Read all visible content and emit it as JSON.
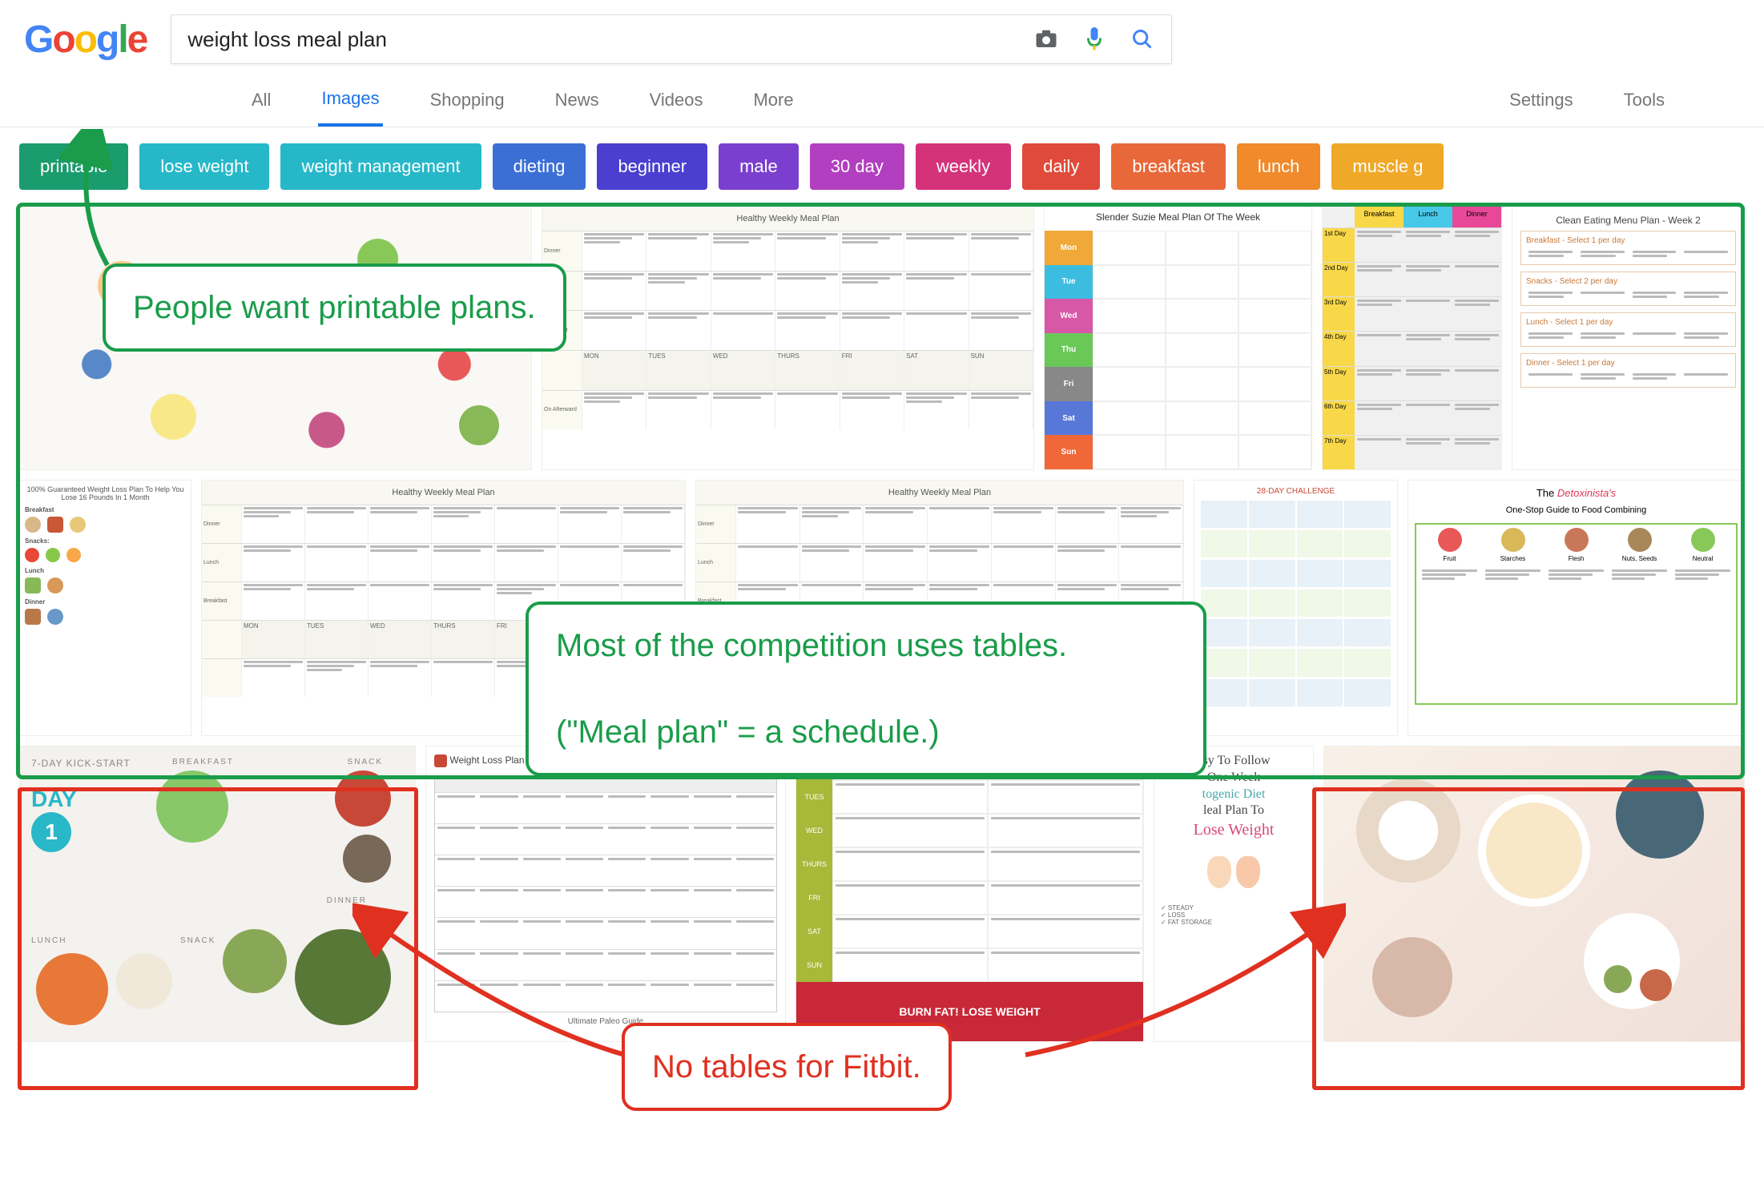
{
  "logo": "Google",
  "search": {
    "query": "weight loss meal plan",
    "camera_icon": "camera",
    "mic_icon": "microphone",
    "search_icon": "search"
  },
  "tabs": {
    "all": "All",
    "images": "Images",
    "shopping": "Shopping",
    "news": "News",
    "videos": "Videos",
    "more": "More",
    "settings": "Settings",
    "tools": "Tools",
    "active": "Images"
  },
  "chips": [
    {
      "label": "printable",
      "color": "#1a9c6e"
    },
    {
      "label": "lose weight",
      "color": "#26b8c9"
    },
    {
      "label": "weight management",
      "color": "#26b8c9"
    },
    {
      "label": "dieting",
      "color": "#3b6fd6"
    },
    {
      "label": "beginner",
      "color": "#4a3fcf"
    },
    {
      "label": "male",
      "color": "#7a3fcf"
    },
    {
      "label": "30 day",
      "color": "#b23fbf"
    },
    {
      "label": "weekly",
      "color": "#d4337a"
    },
    {
      "label": "daily",
      "color": "#e04a3a"
    },
    {
      "label": "breakfast",
      "color": "#e8683a"
    },
    {
      "label": "lunch",
      "color": "#f08a2a"
    },
    {
      "label": "muscle g",
      "color": "#f0a828"
    }
  ],
  "thumbnails": {
    "healthy_weekly": "Healthy Weekly Meal Plan",
    "slender_suzie": "Slender Suzie Meal Plan Of The Week",
    "clean_eating": "Clean Eating Menu Plan - Week 2",
    "breakfast_label": "Breakfast",
    "lunch_label": "Lunch",
    "dinner_label": "Dinner",
    "snacks_label": "Snacks - Select 2 per day",
    "select1": "Select 1 per day",
    "guaranteed": "100% Guaranteed Weight Loss Plan To Help You Lose 16 Pounds In 1 Month",
    "detoxinista": "The Detoxinista's One-Stop Guide to Food Combining",
    "challenge28": "28-DAY CHALLENGE",
    "day7kickstart": "7-DAY KICK-START",
    "day1": "DAY",
    "day1num": "1",
    "breakfast_cap": "BREAKFAST",
    "snack_cap": "SNACK",
    "lunch_cap": "LUNCH",
    "dinner_cap": "DINNER",
    "weight_loss_plan": "Weight Loss Plan",
    "easy_follow": "asy To Follow One Week togenic Diet leal Plan To Lose Weight",
    "burn_fat": "BURN FAT! LOSE WEIGHT",
    "ultimate_paleo": "Ultimate Paleo Guide",
    "days": [
      "Mon",
      "Tue",
      "Wed",
      "Thu",
      "Fri",
      "Sat",
      "Sun"
    ],
    "day_colors": [
      "#f0a838",
      "#3cbde0",
      "#d858a8",
      "#6ac858",
      "#888888",
      "#5878d8",
      "#f06838"
    ],
    "numbered_days": [
      "1st Day",
      "2nd Day",
      "3rd Day",
      "4th Day",
      "5th Day",
      "6th Day",
      "7th Day"
    ],
    "cols": [
      "MON",
      "TUES",
      "WED",
      "THURS",
      "FRI",
      "SAT",
      "SUN"
    ],
    "rows": [
      "Dinner",
      "Lunch",
      "Breakfast",
      "On Afterward"
    ]
  },
  "annotations": {
    "printable": "People want printable plans.",
    "tables": "Most of the competition uses tables.\n\n(\"Meal plan\" = a schedule.)",
    "fitbit": "No tables for Fitbit."
  }
}
